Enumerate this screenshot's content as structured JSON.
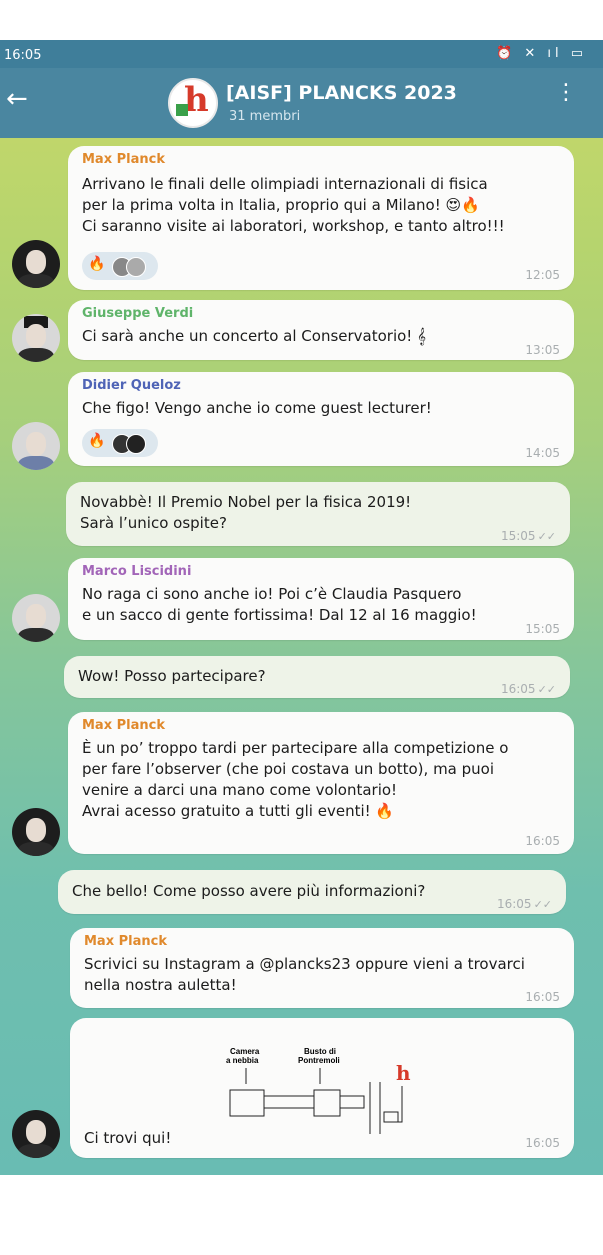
{
  "status": {
    "time": "16:05",
    "icons": "⏰ ✕ ıl ▭"
  },
  "header": {
    "title": "[AISF] PLANCKS 2023",
    "subtitle": "31 membri",
    "back_icon": "arrow-left-icon",
    "menu_icon": "more-vert-icon"
  },
  "colors": {
    "header": "#4a86a0",
    "max_planck": "#e0892c",
    "giuseppe_verdi": "#5fb46a",
    "didier_queloz": "#4f64b6",
    "marco_liscidini": "#a265b8"
  },
  "messages": [
    {
      "sender": "Max Planck",
      "text": "Arrivano le finali delle olimpiadi internazionali di fisica\nper la prima volta in Italia, proprio qui a Milano! 😍🔥\nCi saranno visite ai laboratori, workshop, e tanto altro!!!",
      "time": "12:05",
      "reaction": "🔥"
    },
    {
      "sender": "Giuseppe Verdi",
      "text": "Ci sarà anche un concerto al Conservatorio! 𝄞",
      "time": "13:05"
    },
    {
      "sender": "Didier Queloz",
      "text": "Che figo! Vengo anche io come guest lecturer!",
      "time": "14:05",
      "reaction": "🔥"
    },
    {
      "text": "Novabbè! Il Premio Nobel per la fisica 2019!\nSarà l’unico ospite?",
      "time": "15:05",
      "check": "✓✓"
    },
    {
      "sender": "Marco Liscidini",
      "text": "No raga ci sono anche io! Poi c’è Claudia Pasquero\ne un sacco di gente fortissima! Dal 12 al 16 maggio!",
      "time": "15:05"
    },
    {
      "text": "Wow! Posso partecipare?",
      "time": "16:05",
      "check": "✓✓"
    },
    {
      "sender": "Max Planck",
      "text": "È un po’ troppo tardi per partecipare alla competizione o\nper fare l’observer (che poi costava un botto), ma puoi\nvenire a darci una mano come volontario!\nAvrai acesso gratuito a tutti gli eventi! 🔥",
      "time": "16:05"
    },
    {
      "text": "Che bello! Come posso avere più informazioni?",
      "time": "16:05",
      "check": "✓✓"
    },
    {
      "sender": "Max Planck",
      "text": "Scrivici su Instagram a @plancks23 oppure vieni a trovarci\nnella nostra auletta!",
      "time": "16:05"
    },
    {
      "text": "Ci trovi qui!",
      "time": "16:05",
      "map": {
        "label1": "Camera\na nebbia",
        "label2": "Busto di\nPontremoli"
      }
    }
  ]
}
